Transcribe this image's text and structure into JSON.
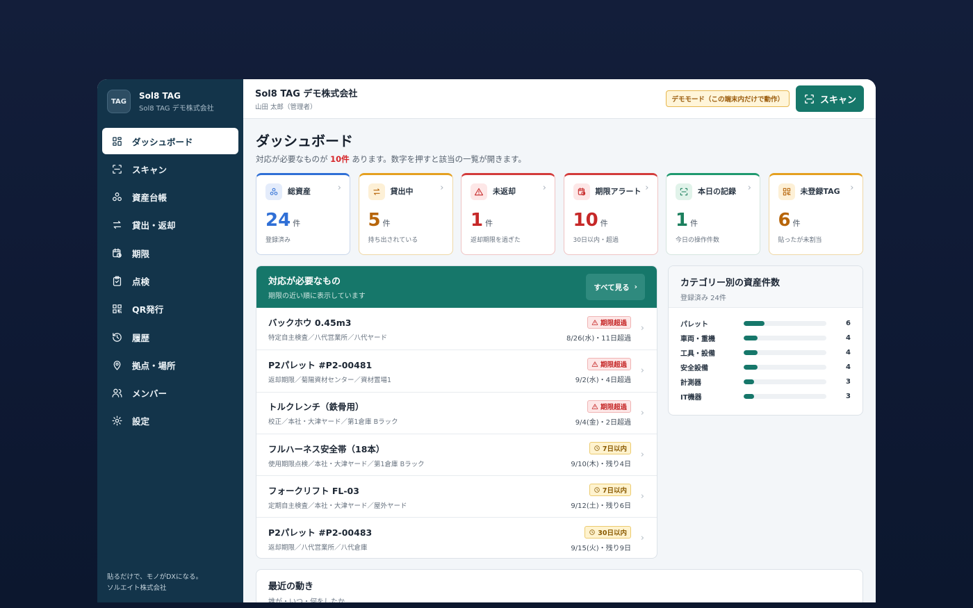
{
  "brand": {
    "logo": "TAG",
    "name": "Sol8 TAG",
    "sub": "Sol8 TAG デモ株式会社"
  },
  "nav": [
    {
      "label": "ダッシュボード",
      "icon": "dashboard-icon",
      "active": true
    },
    {
      "label": "スキャン",
      "icon": "scan-icon"
    },
    {
      "label": "資産台帳",
      "icon": "assets-icon"
    },
    {
      "label": "貸出・返却",
      "icon": "swap-icon"
    },
    {
      "label": "期限",
      "icon": "calendar-clock-icon"
    },
    {
      "label": "点検",
      "icon": "clipboard-check-icon"
    },
    {
      "label": "QR発行",
      "icon": "qr-icon"
    },
    {
      "label": "履歴",
      "icon": "history-icon"
    },
    {
      "label": "拠点・場所",
      "icon": "location-pin-icon"
    },
    {
      "label": "メンバー",
      "icon": "users-icon"
    },
    {
      "label": "設定",
      "icon": "gear-icon"
    }
  ],
  "sidebar_footer": {
    "line1": "貼るだけで、モノがDXになる。",
    "line2": "ソルエイト株式会社"
  },
  "topbar": {
    "org": "Sol8 TAG デモ株式会社",
    "user": "山田 太郎（管理者）",
    "demo_badge": "デモモード（この端末内だけで動作）",
    "scan_label": "スキャン"
  },
  "page": {
    "title": "ダッシュボード",
    "desc_pre": "対応が必要なものが ",
    "desc_count": "10件",
    "desc_post": " あります。数字を押すと該当の一覧が開きます。"
  },
  "kpis": [
    {
      "label": "総資産",
      "value": "24",
      "unit": "件",
      "note": "登録済み",
      "color": "#2f6fd6",
      "icon": "assets-icon"
    },
    {
      "label": "貸出中",
      "value": "5",
      "unit": "件",
      "note": "持ち出されている",
      "color": "#b7650a",
      "icon": "swap-icon"
    },
    {
      "label": "未返却",
      "value": "1",
      "unit": "件",
      "note": "返却期限を過ぎた",
      "color": "#c62828",
      "icon": "warning-icon"
    },
    {
      "label": "期限アラート",
      "value": "10",
      "unit": "件",
      "note": "30日以内・超過",
      "color": "#c62828",
      "icon": "calendar-clock-icon"
    },
    {
      "label": "本日の記録",
      "value": "1",
      "unit": "件",
      "note": "今日の操作件数",
      "color": "#1b7f5d",
      "icon": "scan-icon"
    },
    {
      "label": "未登録TAG",
      "value": "6",
      "unit": "件",
      "note": "貼ったが未割当",
      "color": "#b7650a",
      "icon": "qr-icon"
    }
  ],
  "todo": {
    "title": "対応が必要なもの",
    "sub": "期限の近い順に表示しています",
    "see_all": "すべて見る",
    "items": [
      {
        "title": "バックホウ 0.45m3",
        "sub": "特定自主検査／八代営業所／八代ヤード",
        "badge": "期限超過",
        "type": "over",
        "date": "8/26(水)・11日超過"
      },
      {
        "title": "P2パレット #P2-00481",
        "sub": "返却期限／菊陽資材センター／資材置場1",
        "badge": "期限超過",
        "type": "over",
        "date": "9/2(水)・4日超過"
      },
      {
        "title": "トルクレンチ（鉄骨用）",
        "sub": "校正／本社・大津ヤード／第1倉庫 Bラック",
        "badge": "期限超過",
        "type": "over",
        "date": "9/4(金)・2日超過"
      },
      {
        "title": "フルハーネス安全帯（18本）",
        "sub": "使用期限点検／本社・大津ヤード／第1倉庫 Bラック",
        "badge": "7日以内",
        "type": "soon",
        "date": "9/10(木)・残り4日"
      },
      {
        "title": "フォークリフト FL-03",
        "sub": "定期自主検査／本社・大津ヤード／屋外ヤード",
        "badge": "7日以内",
        "type": "soon",
        "date": "9/12(土)・残り6日"
      },
      {
        "title": "P2パレット #P2-00483",
        "sub": "返却期限／八代営業所／八代倉庫",
        "badge": "30日以内",
        "type": "soon",
        "date": "9/15(火)・残り9日"
      }
    ]
  },
  "categories": {
    "title": "カテゴリー別の資産件数",
    "sub": "登録済み 24件",
    "max": 24,
    "items": [
      {
        "name": "パレット",
        "count": 6
      },
      {
        "name": "車両・重機",
        "count": 4
      },
      {
        "name": "工具・設備",
        "count": 4
      },
      {
        "name": "安全設備",
        "count": 4
      },
      {
        "name": "計測器",
        "count": 3
      },
      {
        "name": "IT機器",
        "count": 3
      }
    ]
  },
  "recent": {
    "title": "最近の動き",
    "sub": "誰が・いつ・何をしたか"
  }
}
